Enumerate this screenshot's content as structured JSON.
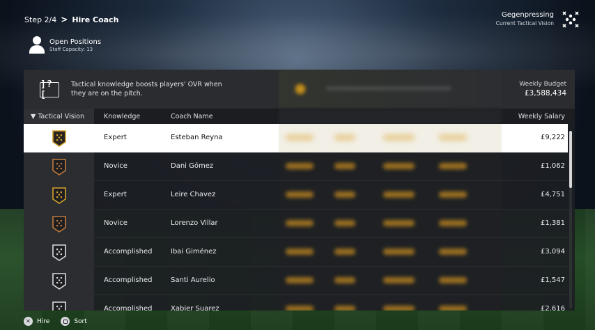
{
  "header": {
    "step": "Step 2/4",
    "chevron": ">",
    "title": "Hire Coach"
  },
  "positions": {
    "title": "Open Positions",
    "capacity": "Staff Capacity: 13"
  },
  "tactical_vision": {
    "name": "Gegenpressing",
    "label": "Current Tactical Vision"
  },
  "info": {
    "icon_text": "]?[",
    "message": "Tactical knowledge boosts players' OVR when they are on the pitch."
  },
  "budget": {
    "label": "Weekly Budget",
    "value": "£3,588,434"
  },
  "columns": {
    "vision": "▼ Tactical Vision",
    "knowledge": "Knowledge",
    "coach": "Coach Name",
    "salary": "Weekly Salary"
  },
  "rows": [
    {
      "knowledge": "Expert",
      "coach": "Esteban Reyna",
      "salary": "£9,222",
      "badge": "gold",
      "selected": true
    },
    {
      "knowledge": "Novice",
      "coach": "Dani Gómez",
      "salary": "£1,062",
      "badge": "bronze"
    },
    {
      "knowledge": "Expert",
      "coach": "Leire Chavez",
      "salary": "£4,751",
      "badge": "gold"
    },
    {
      "knowledge": "Novice",
      "coach": "Lorenzo Villar",
      "salary": "£1,381",
      "badge": "bronze"
    },
    {
      "knowledge": "Accomplished",
      "coach": "Ibai Giménez",
      "salary": "£3,094",
      "badge": "silver"
    },
    {
      "knowledge": "Accomplished",
      "coach": "Santi Aurelio",
      "salary": "£1,547",
      "badge": "silver"
    },
    {
      "knowledge": "Accomplished",
      "coach": "Xabier Suarez",
      "salary": "£2,616",
      "badge": "silver"
    }
  ],
  "footer": {
    "hire_button": "✕",
    "hire_label": "Hire",
    "sort_label": "Sort"
  },
  "colors": {
    "gold": "#d6a22a",
    "bronze": "#c07a3c",
    "silver": "#d8dbe0"
  },
  "icons": {
    "person": "person-icon",
    "formation": "formation-icon",
    "info": "tactics-info-icon"
  }
}
